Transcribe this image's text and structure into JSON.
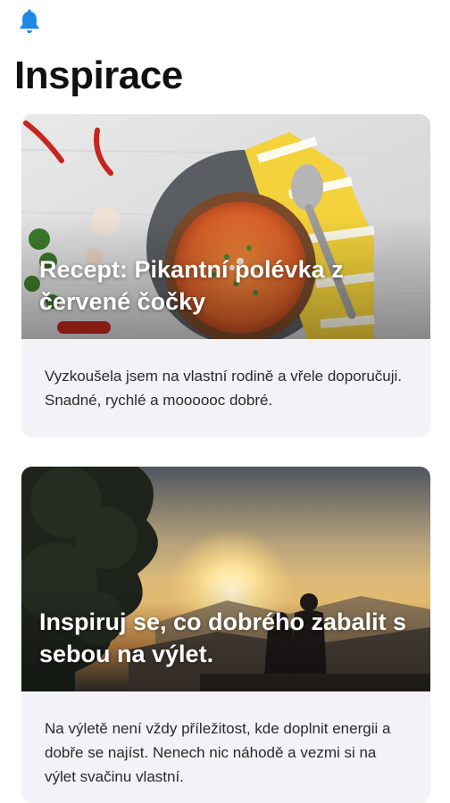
{
  "header": {
    "bell_icon": "bell-icon",
    "title": "Inspirace"
  },
  "cards": [
    {
      "headline": "Recept: Pikantní polévka z červené čočky",
      "description": "Vyzkoušela jsem na vlastní rodině a vřele doporučuji. Snadné, rychlé a moooooc dobré.",
      "image": "lentil-soup-photo"
    },
    {
      "headline": "Inspiruj se, co dobrého zabalit s sebou na výlet.",
      "description": "Na výletě není vždy příležitost, kde doplnit energii a dobře se najíst. Nenech nic náhodě a vezmi si na výlet svačinu vlastní.",
      "image": "sunset-hikers-photo"
    }
  ],
  "colors": {
    "accent": "#1e88e5",
    "card_background": "#f3f2f6"
  }
}
